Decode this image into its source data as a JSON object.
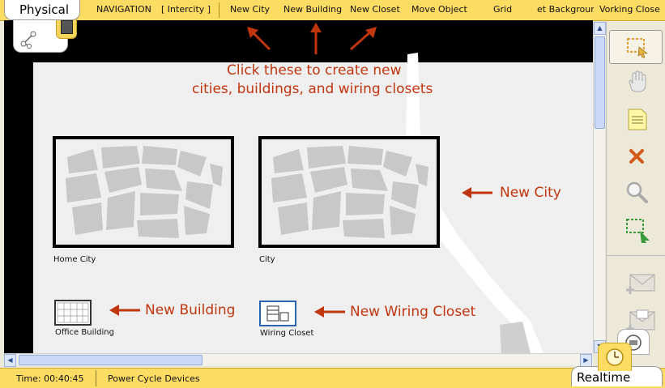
{
  "top_menu": {
    "mode_tab": "Physical",
    "items": [
      "NAVIGATION",
      "[ Intercity ]",
      "New City",
      "New Building",
      "New Closet",
      "Move Object",
      "Grid",
      "et Backgrour",
      "Vorking Close"
    ]
  },
  "canvas": {
    "instruction_line1": "Click these to create new",
    "instruction_line2": "cities, buildings, and wiring closets",
    "cities": [
      {
        "caption": "Home City"
      },
      {
        "caption": "City"
      }
    ],
    "building_caption": "Office Building",
    "closet_caption": "Wiring Closet",
    "annotations": {
      "new_city": "New City",
      "new_building": "New Building",
      "new_wiring_closet": "New Wiring Closet"
    }
  },
  "right_toolbar": {
    "icons": [
      "select-icon",
      "hand-icon",
      "note-icon",
      "delete-icon",
      "magnify-icon",
      "resize-icon",
      "add-simple-pdu-icon",
      "add-complex-pdu-icon"
    ]
  },
  "status": {
    "time": "Time: 00:40:45",
    "power_cycle": "Power Cycle Devices",
    "realtime_tab": "Realtime"
  },
  "colors": {
    "bar_yellow": "#fddc63",
    "annotation": "#c0360f",
    "canvas_bg": "#efefef"
  }
}
